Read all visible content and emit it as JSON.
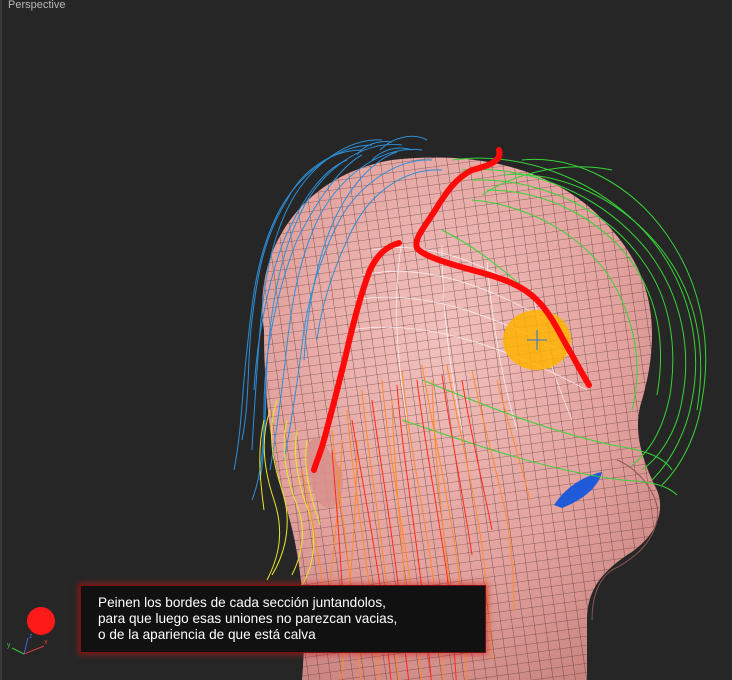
{
  "viewport": {
    "label": "Perspective",
    "background": "#262626"
  },
  "scene": {
    "description_colors": {
      "skin": "#e4a7a3",
      "mesh_line": "#2a1a1a",
      "guide_blue": "#2d8fd8",
      "guide_green": "#37d337",
      "guide_yellow": "#e8e82a",
      "guide_red": "#ff2a1a",
      "guide_orange": "#ff8a2a",
      "brush_highlight": "#ffb300",
      "eye": "#1f5ad8",
      "annotation_stroke": "#ff0a0a"
    }
  },
  "caption": {
    "line1": "Peinen los bordes de cada sección juntandolos,",
    "line2": "para que luego esas uniones no parezcan vacias,",
    "line3": "o de la apariencia de que está calva"
  },
  "axis_gizmo": {
    "x_label": "x",
    "y_label": "y",
    "z_label": "z"
  },
  "record_indicator": {
    "color": "#ff1a1a"
  }
}
